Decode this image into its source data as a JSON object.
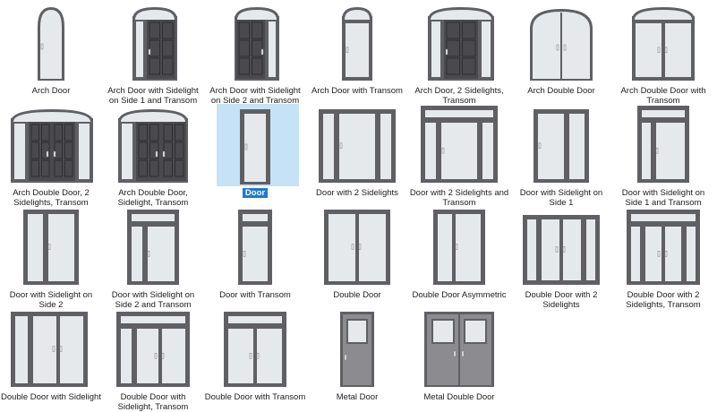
{
  "gallery": {
    "selected_item": "Door",
    "items": [
      {
        "label": "Arch Door",
        "type": "arch-door"
      },
      {
        "label": "Arch Door with Sidelight on Side 1 and Transom",
        "type": "arch-sl1-transom"
      },
      {
        "label": "Arch Door with Sidelight on Side 2 and Transom",
        "type": "arch-sl2-transom"
      },
      {
        "label": "Arch Door with Transom",
        "type": "arch-transom"
      },
      {
        "label": "Arch Door, 2 Sidelights, Transom",
        "type": "arch-2sl-transom"
      },
      {
        "label": "Arch Double Door",
        "type": "arch-double"
      },
      {
        "label": "Arch Double Door with Transom",
        "type": "arch-double-transom"
      },
      {
        "label": "Arch Double Door, 2 Sidelights, Transom",
        "type": "arch-double-2sl-transom"
      },
      {
        "label": "Arch Double Door, Sidelight, Transom",
        "type": "arch-double-sl-transom"
      },
      {
        "label": "Door",
        "type": "door"
      },
      {
        "label": "Door with 2 Sidelights",
        "type": "door-2sl"
      },
      {
        "label": "Door with 2 Sidelights and Transom",
        "type": "door-2sl-transom"
      },
      {
        "label": "Door with Sidelight on Side 1",
        "type": "door-sl1"
      },
      {
        "label": "Door with Sidelight on Side 1 and Transom",
        "type": "door-sl1-transom"
      },
      {
        "label": "Door with Sidelight on Side 2",
        "type": "door-sl2"
      },
      {
        "label": "Door with Sidelight on Side 2 and Transom",
        "type": "door-sl2-transom"
      },
      {
        "label": "Door with Transom",
        "type": "door-transom"
      },
      {
        "label": "Double Door",
        "type": "double"
      },
      {
        "label": "Double Door Asymmetric",
        "type": "double-asym"
      },
      {
        "label": "Double Door with 2 Sidelights",
        "type": "double-2sl"
      },
      {
        "label": "Double Door with 2 Sidelights, Transom",
        "type": "double-2sl-transom"
      },
      {
        "label": "Double Door with Sidelight",
        "type": "double-sl"
      },
      {
        "label": "Double Door with Sidelight, Transom",
        "type": "double-sl-transom"
      },
      {
        "label": "Double Door with Transom",
        "type": "double-transom"
      },
      {
        "label": "Metal Door",
        "type": "metal"
      },
      {
        "label": "Metal Double Door",
        "type": "metal-double"
      }
    ]
  },
  "colors": {
    "frame": "#5f5f64",
    "glass": "#e6e9ec",
    "panel": "#4a4a4e",
    "metal": "#8c8c90",
    "selection_bg": "#c6e2f7",
    "selection_label": "#1e7ad2"
  }
}
